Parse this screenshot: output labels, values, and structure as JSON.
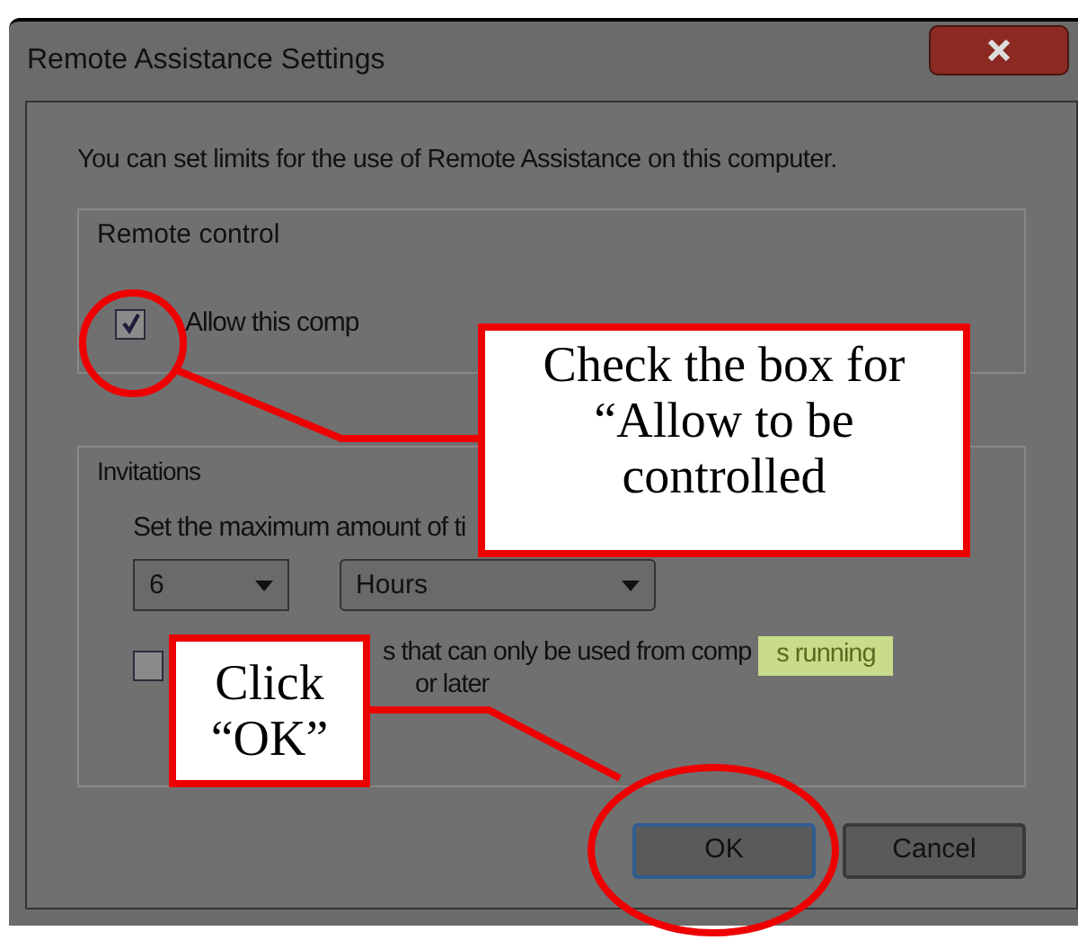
{
  "window": {
    "title": "Remote Assistance Settings"
  },
  "intro": "You can set limits for the use of Remote Assistance on this computer.",
  "remote_control": {
    "label": "Remote control",
    "checkbox": {
      "label": "Allow this comp",
      "checked": true
    }
  },
  "invitations": {
    "label": "Invitations",
    "text": "Set the maximum amount of ti",
    "number": {
      "value": "6"
    },
    "unit": {
      "value": "Hours"
    },
    "checkbox": {
      "label_lines": [
        "s that can only be used from comp",
        "or later"
      ],
      "checked": false
    },
    "side_text": "s running"
  },
  "buttons": [
    {
      "label": "OK",
      "default": true
    },
    {
      "label": "Cancel",
      "default": false
    }
  ],
  "annotations": [
    {
      "lines": [
        "Check the box for",
        "“Allow to be",
        "controlled"
      ]
    },
    {
      "lines": [
        "Click",
        "“OK”"
      ]
    }
  ]
}
